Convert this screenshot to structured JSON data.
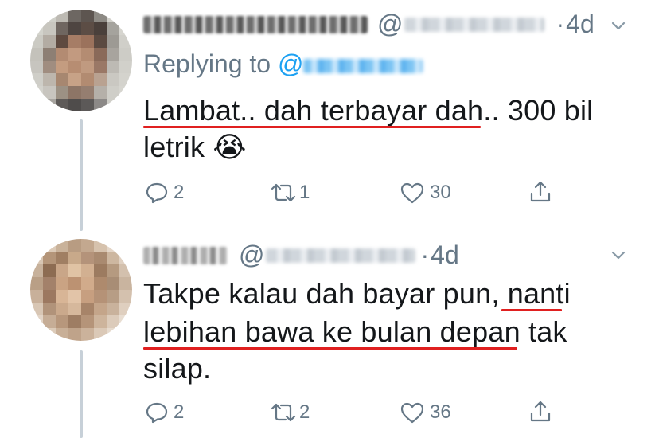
{
  "tweets": [
    {
      "time": "4d",
      "replying_label": "Replying to",
      "replying_at": "@",
      "text_lines": [
        "Lambat.. dah terbayar dah.. 300 bil",
        "letrik 😭"
      ],
      "counts": {
        "replies": "2",
        "retweets": "1",
        "likes": "30"
      }
    },
    {
      "time": "4d",
      "text_lines": [
        "Takpe kalau dah bayar pun, nanti",
        "lebihan bawa ke bulan depan tak",
        "silap."
      ],
      "counts": {
        "replies": "2",
        "retweets": "2",
        "likes": "36"
      }
    }
  ],
  "at_symbol": "@",
  "dot": "·",
  "colors": {
    "text": "#14171a",
    "muted": "#657786",
    "link": "#1da1f2",
    "highlight": "#e02020",
    "thread": "#c7d0d8"
  },
  "icons": [
    "avatar",
    "chevron-down-icon",
    "reply-icon",
    "retweet-icon",
    "like-icon",
    "share-icon"
  ]
}
